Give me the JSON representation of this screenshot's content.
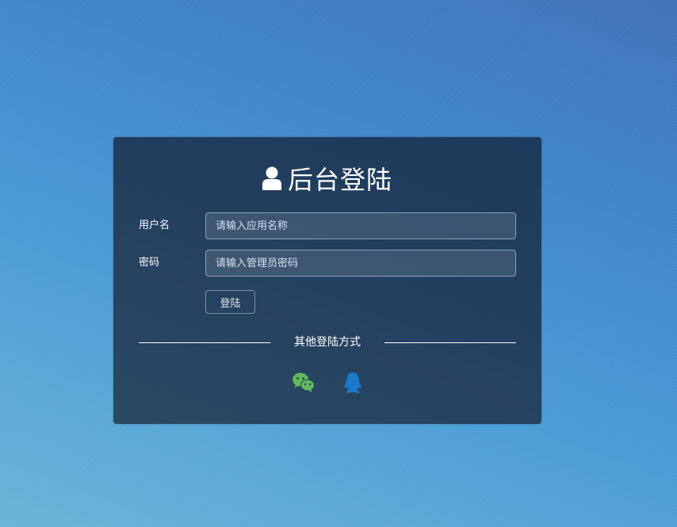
{
  "login": {
    "title": "后台登陆",
    "title_icon": "user-icon",
    "username_label": "用户名",
    "username_placeholder": "请输入应用名称",
    "username_value": "",
    "password_label": "密码",
    "password_placeholder": "请输入管理员密码",
    "password_value": "",
    "submit_label": "登陆",
    "other_methods_label": "其他登陆方式",
    "social": [
      {
        "icon": "wechat-icon",
        "color": "#62b85c"
      },
      {
        "icon": "qq-icon",
        "color": "#1b79c9"
      }
    ]
  },
  "colors": {
    "panel": "#1f3d5e",
    "text": "#ffffff"
  }
}
